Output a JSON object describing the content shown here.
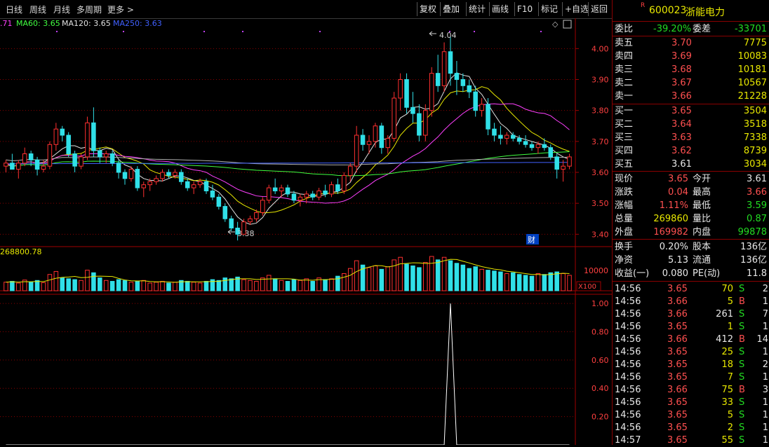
{
  "toolbar": {
    "tabs": [
      "日线",
      "周线",
      "月线",
      "多周期",
      "更多 >"
    ],
    "buttons": [
      "复权",
      "叠加",
      "统计",
      "画线",
      "F10",
      "标记",
      "+自选",
      "返回"
    ]
  },
  "ma_labels": [
    {
      "text": ".71",
      "color": "#ff40ff"
    },
    {
      "text": "MA60: 3.65",
      "color": "#40ff40"
    },
    {
      "text": "MA120: 3.65",
      "color": "#e0e0e0"
    },
    {
      "text": "MA250: 3.63",
      "color": "#4060ff"
    }
  ],
  "price_chart": {
    "price_ticks": [
      "4.00",
      "3.90",
      "3.80",
      "3.70",
      "3.60",
      "3.50",
      "3.40"
    ],
    "high_marker": "4.04",
    "low_marker": "3.38",
    "cai_label": "财",
    "volume_label": "268800.78",
    "volume_tick": "10000",
    "volume_unit": "X100",
    "indicator_ticks": [
      "1.00",
      "0.80",
      "0.60",
      "0.40",
      "0.20"
    ]
  },
  "chart_data": {
    "type": "candlestick",
    "price_range": [
      3.36,
      4.08
    ],
    "indicator_range": [
      0,
      1.06
    ],
    "ohlc": [
      [
        3.62,
        3.64,
        3.6,
        3.63
      ],
      [
        3.63,
        3.66,
        3.61,
        3.61
      ],
      [
        3.61,
        3.64,
        3.58,
        3.63
      ],
      [
        3.63,
        3.68,
        3.62,
        3.66
      ],
      [
        3.66,
        3.67,
        3.62,
        3.64
      ],
      [
        3.64,
        3.65,
        3.59,
        3.61
      ],
      [
        3.61,
        3.64,
        3.6,
        3.62
      ],
      [
        3.62,
        3.7,
        3.61,
        3.69
      ],
      [
        3.69,
        3.76,
        3.67,
        3.74
      ],
      [
        3.74,
        3.75,
        3.7,
        3.72
      ],
      [
        3.72,
        3.73,
        3.65,
        3.66
      ],
      [
        3.66,
        3.67,
        3.6,
        3.62
      ],
      [
        3.62,
        3.66,
        3.61,
        3.65
      ],
      [
        3.65,
        3.78,
        3.64,
        3.76
      ],
      [
        3.76,
        3.81,
        3.65,
        3.67
      ],
      [
        3.67,
        3.68,
        3.63,
        3.65
      ],
      [
        3.65,
        3.67,
        3.63,
        3.66
      ],
      [
        3.66,
        3.67,
        3.62,
        3.63
      ],
      [
        3.63,
        3.64,
        3.58,
        3.6
      ],
      [
        3.6,
        3.61,
        3.56,
        3.58
      ],
      [
        3.58,
        3.62,
        3.57,
        3.61
      ],
      [
        3.61,
        3.62,
        3.54,
        3.55
      ],
      [
        3.55,
        3.57,
        3.52,
        3.56
      ],
      [
        3.56,
        3.58,
        3.54,
        3.57
      ],
      [
        3.57,
        3.59,
        3.56,
        3.58
      ],
      [
        3.58,
        3.61,
        3.57,
        3.6
      ],
      [
        3.6,
        3.61,
        3.58,
        3.59
      ],
      [
        3.59,
        3.61,
        3.58,
        3.6
      ],
      [
        3.6,
        3.61,
        3.56,
        3.57
      ],
      [
        3.57,
        3.58,
        3.54,
        3.55
      ],
      [
        3.55,
        3.57,
        3.53,
        3.56
      ],
      [
        3.56,
        3.58,
        3.55,
        3.57
      ],
      [
        3.57,
        3.58,
        3.53,
        3.54
      ],
      [
        3.54,
        3.56,
        3.51,
        3.52
      ],
      [
        3.52,
        3.53,
        3.48,
        3.49
      ],
      [
        3.49,
        3.5,
        3.44,
        3.45
      ],
      [
        3.45,
        3.46,
        3.41,
        3.42
      ],
      [
        3.42,
        3.44,
        3.38,
        3.4
      ],
      [
        3.4,
        3.45,
        3.4,
        3.44
      ],
      [
        3.44,
        3.46,
        3.43,
        3.45
      ],
      [
        3.45,
        3.48,
        3.44,
        3.47
      ],
      [
        3.47,
        3.52,
        3.46,
        3.51
      ],
      [
        3.51,
        3.56,
        3.5,
        3.55
      ],
      [
        3.55,
        3.58,
        3.53,
        3.54
      ],
      [
        3.54,
        3.56,
        3.52,
        3.55
      ],
      [
        3.55,
        3.56,
        3.52,
        3.53
      ],
      [
        3.53,
        3.54,
        3.5,
        3.51
      ],
      [
        3.51,
        3.53,
        3.49,
        3.52
      ],
      [
        3.52,
        3.54,
        3.5,
        3.53
      ],
      [
        3.53,
        3.54,
        3.51,
        3.52
      ],
      [
        3.52,
        3.55,
        3.51,
        3.54
      ],
      [
        3.54,
        3.56,
        3.52,
        3.53
      ],
      [
        3.53,
        3.57,
        3.52,
        3.56
      ],
      [
        3.56,
        3.58,
        3.53,
        3.54
      ],
      [
        3.54,
        3.6,
        3.53,
        3.59
      ],
      [
        3.59,
        3.63,
        3.57,
        3.62
      ],
      [
        3.62,
        3.75,
        3.6,
        3.72
      ],
      [
        3.72,
        3.74,
        3.67,
        3.69
      ],
      [
        3.69,
        3.72,
        3.66,
        3.7
      ],
      [
        3.7,
        3.76,
        3.68,
        3.75
      ],
      [
        3.75,
        3.76,
        3.66,
        3.68
      ],
      [
        3.68,
        3.72,
        3.66,
        3.71
      ],
      [
        3.71,
        3.86,
        3.7,
        3.84
      ],
      [
        3.84,
        3.92,
        3.8,
        3.9
      ],
      [
        3.9,
        3.92,
        3.79,
        3.81
      ],
      [
        3.81,
        3.86,
        3.76,
        3.79
      ],
      [
        3.79,
        3.82,
        3.7,
        3.72
      ],
      [
        3.72,
        3.82,
        3.7,
        3.8
      ],
      [
        3.8,
        3.94,
        3.78,
        3.92
      ],
      [
        3.92,
        3.98,
        3.86,
        3.88
      ],
      [
        3.88,
        4.02,
        3.86,
        3.99
      ],
      [
        3.99,
        4.04,
        3.88,
        3.92
      ],
      [
        3.92,
        3.96,
        3.85,
        3.9
      ],
      [
        3.9,
        3.92,
        3.86,
        3.88
      ],
      [
        3.88,
        3.9,
        3.84,
        3.86
      ],
      [
        3.86,
        3.88,
        3.78,
        3.8
      ],
      [
        3.8,
        3.84,
        3.78,
        3.82
      ],
      [
        3.82,
        3.84,
        3.72,
        3.74
      ],
      [
        3.74,
        3.76,
        3.7,
        3.72
      ],
      [
        3.72,
        3.75,
        3.69,
        3.71
      ],
      [
        3.71,
        3.73,
        3.69,
        3.72
      ],
      [
        3.72,
        3.73,
        3.7,
        3.71
      ],
      [
        3.71,
        3.72,
        3.69,
        3.7
      ],
      [
        3.7,
        3.72,
        3.68,
        3.69
      ],
      [
        3.69,
        3.7,
        3.67,
        3.68
      ],
      [
        3.68,
        3.7,
        3.66,
        3.69
      ],
      [
        3.69,
        3.71,
        3.67,
        3.68
      ],
      [
        3.68,
        3.69,
        3.64,
        3.65
      ],
      [
        3.65,
        3.66,
        3.58,
        3.61
      ],
      [
        3.61,
        3.64,
        3.57,
        3.62
      ],
      [
        3.62,
        3.66,
        3.61,
        3.65
      ]
    ],
    "volume": [
      20,
      22,
      18,
      25,
      20,
      24,
      19,
      38,
      45,
      30,
      28,
      26,
      24,
      48,
      42,
      30,
      24,
      22,
      26,
      24,
      20,
      22,
      24,
      18,
      20,
      22,
      18,
      20,
      24,
      22,
      20,
      18,
      22,
      26,
      24,
      30,
      28,
      32,
      26,
      24,
      22,
      30,
      36,
      28,
      24,
      22,
      26,
      24,
      28,
      22,
      30,
      26,
      28,
      34,
      40,
      52,
      70,
      60,
      54,
      58,
      50,
      56,
      72,
      78,
      62,
      58,
      54,
      66,
      80,
      72,
      78,
      70,
      64,
      60,
      52,
      56,
      50,
      48,
      46,
      44,
      40,
      42,
      38,
      36,
      34,
      40,
      38,
      42,
      44,
      40,
      36
    ],
    "indicator": {
      "spike_index": 71,
      "spike_value": 1.0
    }
  },
  "quote": {
    "code": "600023",
    "name": "浙能电力",
    "r_mark": "R",
    "weibi_label": "委比",
    "weibi_value": "-39.20%",
    "weicha_label": "委差",
    "weicha_value": "-33701",
    "asks": [
      {
        "label": "卖五",
        "price": "3.70",
        "vol": "7775"
      },
      {
        "label": "卖四",
        "price": "3.69",
        "vol": "10083"
      },
      {
        "label": "卖三",
        "price": "3.68",
        "vol": "10181"
      },
      {
        "label": "卖二",
        "price": "3.67",
        "vol": "10567"
      },
      {
        "label": "卖一",
        "price": "3.66",
        "vol": "21228"
      }
    ],
    "bids": [
      {
        "label": "买一",
        "price": "3.65",
        "vol": "3504"
      },
      {
        "label": "买二",
        "price": "3.64",
        "vol": "3518"
      },
      {
        "label": "买三",
        "price": "3.63",
        "vol": "7338"
      },
      {
        "label": "买四",
        "price": "3.62",
        "vol": "8739"
      },
      {
        "label": "买五",
        "price": "3.61",
        "vol": "3034"
      }
    ],
    "stats": [
      {
        "l1": "现价",
        "v1": "3.65",
        "c1": "red",
        "l2": "今开",
        "v2": "3.61",
        "c2": "white"
      },
      {
        "l1": "涨跌",
        "v1": "0.04",
        "c1": "red",
        "l2": "最高",
        "v2": "3.66",
        "c2": "red"
      },
      {
        "l1": "涨幅",
        "v1": "1.11%",
        "c1": "red",
        "l2": "最低",
        "v2": "3.59",
        "c2": "green"
      },
      {
        "l1": "总量",
        "v1": "269860",
        "c1": "yellow",
        "l2": "量比",
        "v2": "0.87",
        "c2": "green"
      },
      {
        "l1": "外盘",
        "v1": "169982",
        "c1": "red",
        "l2": "内盘",
        "v2": "99878",
        "c2": "green"
      }
    ],
    "fundamentals": [
      {
        "l1": "换手",
        "v1": "0.20%",
        "l2": "股本",
        "v2": "136亿"
      },
      {
        "l1": "净资",
        "v1": "5.13",
        "l2": "流通",
        "v2": "136亿"
      },
      {
        "l1": "收益(一)",
        "v1": "0.080",
        "l2": "PE(动)",
        "v2": "11.8"
      }
    ]
  },
  "ticks": [
    {
      "time": "14:56",
      "price": "3.65",
      "vol": "70",
      "side": "S",
      "n": "2"
    },
    {
      "time": "14:56",
      "price": "3.66",
      "vol": "5",
      "side": "B",
      "n": "1"
    },
    {
      "time": "14:56",
      "price": "3.66",
      "vol": "261",
      "side": "S",
      "n": "7"
    },
    {
      "time": "14:56",
      "price": "3.65",
      "vol": "1",
      "side": "S",
      "n": "1"
    },
    {
      "time": "14:56",
      "price": "3.66",
      "vol": "412",
      "side": "B",
      "n": "14"
    },
    {
      "time": "14:56",
      "price": "3.65",
      "vol": "25",
      "side": "S",
      "n": "1"
    },
    {
      "time": "14:56",
      "price": "3.65",
      "vol": "18",
      "side": "S",
      "n": "2"
    },
    {
      "time": "14:56",
      "price": "3.65",
      "vol": "7",
      "side": "S",
      "n": "1"
    },
    {
      "time": "14:56",
      "price": "3.66",
      "vol": "75",
      "side": "B",
      "n": "3"
    },
    {
      "time": "14:56",
      "price": "3.65",
      "vol": "33",
      "side": "S",
      "n": "1"
    },
    {
      "time": "14:56",
      "price": "3.65",
      "vol": "5",
      "side": "S",
      "n": "1"
    },
    {
      "time": "14:56",
      "price": "3.65",
      "vol": "2",
      "side": "S",
      "n": "1"
    },
    {
      "time": "14:57",
      "price": "3.65",
      "vol": "55",
      "side": "S",
      "n": "1"
    }
  ],
  "colors": {
    "up": "#ff3030",
    "down": "#30e0e8",
    "grid": "#8a0000",
    "axis": "#a00000"
  }
}
